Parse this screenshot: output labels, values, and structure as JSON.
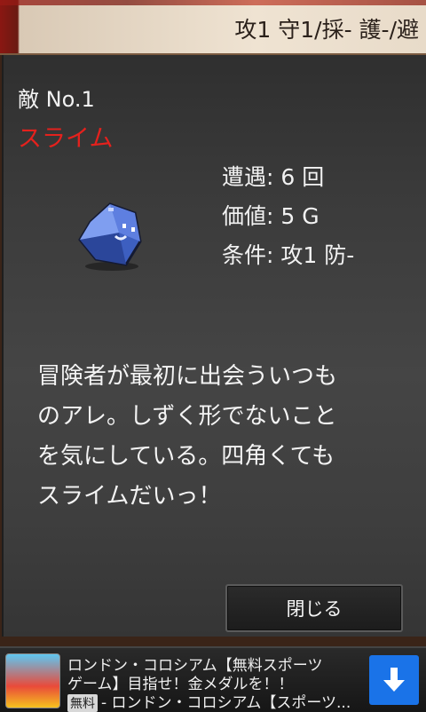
{
  "header": {
    "stats": "攻1 守1/採- 護-/避"
  },
  "enemy": {
    "number_label": "敵 No.1",
    "name": "スライム",
    "encounters": "遭遇: 6 回",
    "value": "価値: 5 G",
    "condition": "条件: 攻1 防-",
    "description_lines": [
      "冒険者が最初に出会ういつも",
      "のアレ。しずく形でないこと",
      "を気にしている。四角くても",
      "スライムだいっ！"
    ]
  },
  "close_label": "閉じる",
  "ad": {
    "line1": "ロンドン・コロシアム【無料スポーツ",
    "line2": "ゲーム】目指せ！金メダルを！！",
    "badge": "無料",
    "line3": "- ロンドン・コロシアム【スポーツ...",
    "icon": "app-icon",
    "download_icon": "download-arrow-icon",
    "download_color": "#1a73e8"
  },
  "colors": {
    "enemy_name": "#e4211d",
    "panel": "#3b3b3b",
    "text": "#f2f2f2"
  }
}
